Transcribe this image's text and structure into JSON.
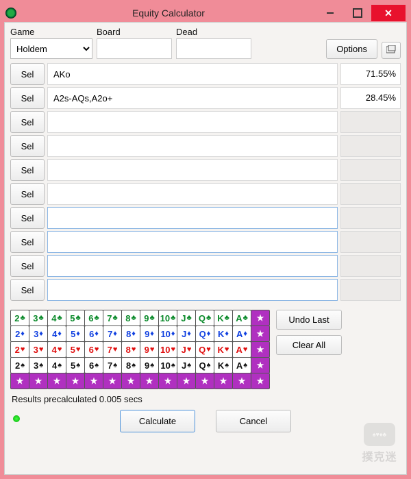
{
  "window": {
    "title": "Equity Calculator"
  },
  "top": {
    "game_label": "Game",
    "board_label": "Board",
    "dead_label": "Dead",
    "game_value": "Holdem",
    "board_value": "",
    "dead_value": "",
    "options_label": "Options"
  },
  "sel_label": "Sel",
  "rows": [
    {
      "hand": "AKo",
      "equity": "71.55%",
      "style": "norm",
      "filled": true
    },
    {
      "hand": "A2s-AQs,A2o+",
      "equity": "28.45%",
      "style": "norm",
      "filled": true
    },
    {
      "hand": "",
      "equity": "",
      "style": "norm",
      "filled": false
    },
    {
      "hand": "",
      "equity": "",
      "style": "norm",
      "filled": false
    },
    {
      "hand": "",
      "equity": "",
      "style": "norm",
      "filled": false
    },
    {
      "hand": "",
      "equity": "",
      "style": "norm",
      "filled": false
    },
    {
      "hand": "",
      "equity": "",
      "style": "blue",
      "filled": false
    },
    {
      "hand": "",
      "equity": "",
      "style": "blue",
      "filled": false
    },
    {
      "hand": "",
      "equity": "",
      "style": "blue",
      "filled": false
    },
    {
      "hand": "",
      "equity": "",
      "style": "blue",
      "filled": false
    }
  ],
  "deck": {
    "ranks": [
      "2",
      "3",
      "4",
      "5",
      "6",
      "7",
      "8",
      "9",
      "10",
      "J",
      "Q",
      "K",
      "A"
    ],
    "suits": [
      {
        "name": "clubs",
        "sym": "♣",
        "cls": "clubs"
      },
      {
        "name": "diamonds",
        "sym": "♦",
        "cls": "diamonds"
      },
      {
        "name": "hearts",
        "sym": "♥",
        "cls": "hearts"
      },
      {
        "name": "spades",
        "sym": "♠",
        "cls": "spades"
      }
    ]
  },
  "buttons": {
    "undo_last": "Undo Last",
    "clear_all": "Clear All",
    "calculate": "Calculate",
    "cancel": "Cancel"
  },
  "status": "Results precalculated 0.005 secs",
  "watermark": "撲克迷"
}
